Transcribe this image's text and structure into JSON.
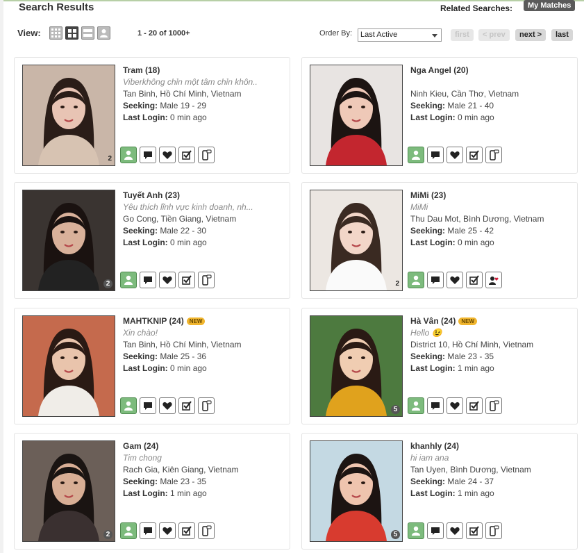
{
  "header": {
    "title": "Search Results",
    "related_label": "Related Searches:",
    "my_matches": "My Matches"
  },
  "toolbar": {
    "view_label": "View:",
    "view_modes": [
      "grid-small-icon",
      "grid-large-icon",
      "list-icon",
      "profile-icon"
    ],
    "range": "1 - 20 of 1000+",
    "order_label": "Order By:",
    "order_value": "Last Active",
    "pagination": {
      "first": "first",
      "prev": "< prev",
      "next": "next >",
      "last": "last"
    }
  },
  "labels": {
    "seeking": "Seeking:",
    "last_login": "Last Login:"
  },
  "results": [
    {
      "name": "Tram (18)",
      "is_new": false,
      "tagline": "Viberkhông chỉn một tâm chỉn khôn..",
      "location": "Tan Binh, Hồ Chí Minh, Vietnam",
      "seeking": "Male 19 - 29",
      "last_login": "0 min ago",
      "photo_count": "2",
      "photo_count_style": "plain",
      "last_action": "phone-icon"
    },
    {
      "name": "Nga Angel (20)",
      "is_new": false,
      "tagline": "",
      "location": "Ninh Kieu, Cần Thơ, Vietnam",
      "seeking": "Male 21 - 40",
      "last_login": "0 min ago",
      "photo_count": "",
      "photo_count_style": "plain",
      "last_action": "phone-icon"
    },
    {
      "name": "Tuyết Anh (23)",
      "is_new": false,
      "tagline": "Yêu thích lĩnh vực kinh doanh, nh...",
      "location": "Go Cong, Tiền Giang, Vietnam",
      "seeking": "Male 22 - 30",
      "last_login": "0 min ago",
      "photo_count": "2",
      "photo_count_style": "circle",
      "last_action": "phone-icon"
    },
    {
      "name": "MiMi (23)",
      "is_new": false,
      "tagline": "MiMi",
      "location": "Thu Dau Mot, Bình Dương, Vietnam",
      "seeking": "Male 25 - 42",
      "last_login": "0 min ago",
      "photo_count": "2",
      "photo_count_style": "plain",
      "last_action": "contact-heart-icon"
    },
    {
      "name": "MAHTKNIP (24)",
      "is_new": true,
      "new_label": "NEW",
      "tagline": "Xin chào!",
      "location": "Tan Binh, Hồ Chí Minh, Vietnam",
      "seeking": "Male 25 - 36",
      "last_login": "0 min ago",
      "photo_count": "",
      "photo_count_style": "plain",
      "last_action": "phone-icon"
    },
    {
      "name": "Hà Vân (24)",
      "is_new": true,
      "new_label": "NEW",
      "tagline": "Hello 😉",
      "location": "District 10, Hồ Chí Minh, Vietnam",
      "seeking": "Male 23 - 35",
      "last_login": "1 min ago",
      "photo_count": "5",
      "photo_count_style": "circle",
      "last_action": "phone-icon"
    },
    {
      "name": "Gam (24)",
      "is_new": false,
      "tagline": "Tim chong",
      "location": "Rach Gia, Kiên Giang, Vietnam",
      "seeking": "Male 23 - 35",
      "last_login": "1 min ago",
      "photo_count": "2",
      "photo_count_style": "circle",
      "last_action": "phone-icon"
    },
    {
      "name": "khanhly (24)",
      "is_new": false,
      "tagline": "hi iam ana",
      "location": "Tan Uyen, Bình Dương, Vietnam",
      "seeking": "Male 24 - 37",
      "last_login": "1 min ago",
      "photo_count": "5",
      "photo_count_style": "circle",
      "last_action": "phone-icon"
    }
  ],
  "colors": {
    "accent_border": "#b7cfa6",
    "action_green": "#7dbb7d",
    "new_badge": "#f0b52e"
  }
}
